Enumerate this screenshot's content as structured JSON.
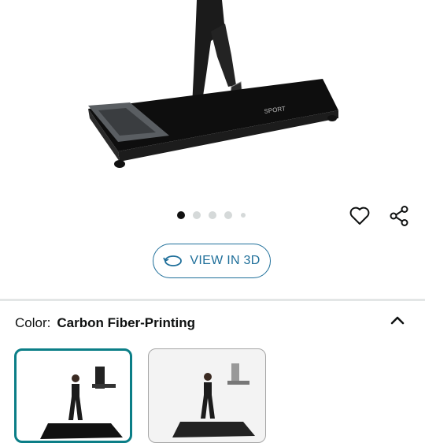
{
  "product": {
    "brand_on_deck": "SPORT",
    "carousel": {
      "total": 5,
      "active_index": 0
    }
  },
  "actions": {
    "wishlist_icon": "heart-icon",
    "share_icon": "share-icon",
    "view3d_label": "VIEW IN 3D",
    "view3d_icon": "rotate-3d-icon"
  },
  "variation": {
    "label": "Color:",
    "selected": "Carbon Fiber-Printing",
    "expand_icon": "chevron-up-icon",
    "swatches": [
      {
        "name": "Carbon Fiber-Printing",
        "selected": true
      },
      {
        "name": "alt-color",
        "selected": false
      }
    ]
  },
  "colors": {
    "accent": "#0b7e87",
    "link": "#1f6f9a",
    "divider": "#e3e6e6"
  }
}
